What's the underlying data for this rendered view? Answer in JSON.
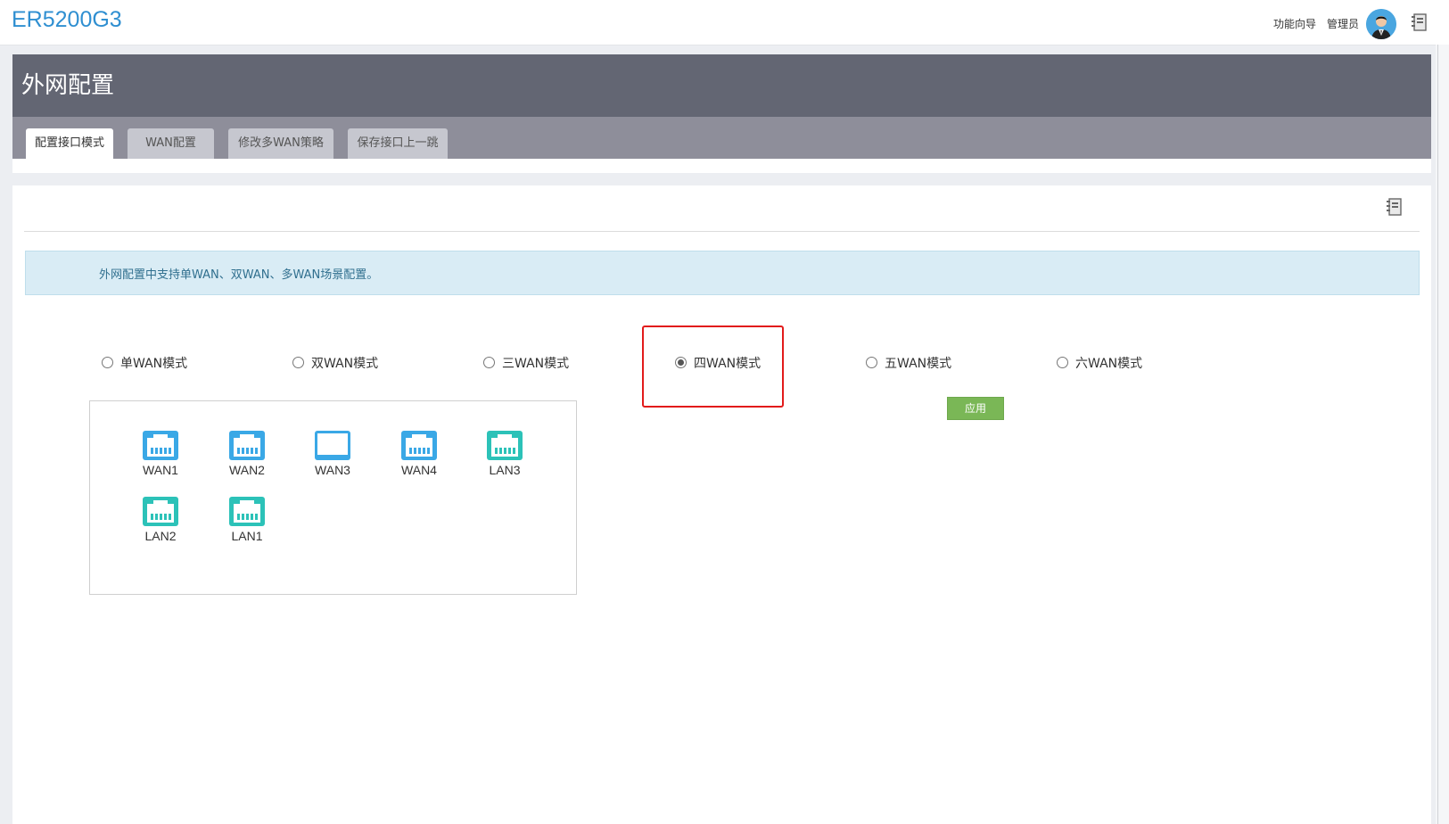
{
  "app": {
    "brand": "ER5200G3"
  },
  "topbar": {
    "wizard": "功能向导",
    "user": "管理员"
  },
  "header": {
    "title": "外网配置"
  },
  "tabs": [
    {
      "label": "配置接口模式",
      "active": true
    },
    {
      "label": "WAN配置",
      "active": false
    },
    {
      "label": "修改多WAN策略",
      "active": false
    },
    {
      "label": "保存接口上一跳",
      "active": false
    }
  ],
  "info": {
    "text": "外网配置中支持单WAN、双WAN、多WAN场景配置。"
  },
  "modes": [
    {
      "label": "单WAN模式",
      "selected": false
    },
    {
      "label": "双WAN模式",
      "selected": false
    },
    {
      "label": "三WAN模式",
      "selected": false
    },
    {
      "label": "四WAN模式",
      "selected": true
    },
    {
      "label": "五WAN模式",
      "selected": false
    },
    {
      "label": "六WAN模式",
      "selected": false
    }
  ],
  "apply_label": "应用",
  "ports": [
    {
      "label": "WAN1",
      "type": "wan",
      "state": "connected"
    },
    {
      "label": "WAN2",
      "type": "wan",
      "state": "connected"
    },
    {
      "label": "WAN3",
      "type": "wan",
      "state": "disconnected"
    },
    {
      "label": "WAN4",
      "type": "wan",
      "state": "connected"
    },
    {
      "label": "LAN3",
      "type": "lan",
      "state": "connected"
    },
    {
      "label": "LAN2",
      "type": "lan",
      "state": "connected"
    },
    {
      "label": "LAN1",
      "type": "lan",
      "state": "connected"
    }
  ],
  "colors": {
    "brand": "#2f8fd1",
    "wan_port": "#3aa8e6",
    "lan_port": "#2cc2b8",
    "apply": "#7ab756",
    "highlight": "#e21b1b",
    "info_bg": "#d9ecf5",
    "info_text": "#31708f"
  }
}
